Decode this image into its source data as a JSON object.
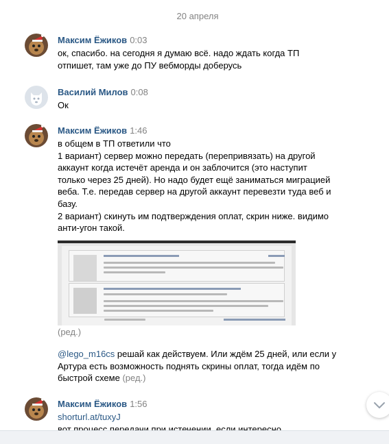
{
  "date_separator": "20 апреля",
  "messages": [
    {
      "author": "Максим Ёжиков",
      "time": "0:03",
      "lines": [
        "ок, спасибо. на сегодня я думаю всё. надо ждать когда ТП",
        "отпишет, там уже до ПУ вебморды доберусь"
      ]
    },
    {
      "author": "Василий Милов",
      "time": "0:08",
      "lines": [
        "Ок"
      ]
    },
    {
      "author": "Максим Ёжиков",
      "time": "1:46",
      "lines": [
        "в общем в ТП ответили что",
        "1 вариант) сервер можно передать (перепривязать) на другой",
        "аккаунт когда истечёт аренда и он заблочится (это наступит",
        "только через 25 дней). Но надо будет ещё заниматься миграцией",
        "веба. Т.е. передав сервер на другой аккаунт перевезти туда веб и",
        "базу.",
        "2 вариант) скинуть им подтверждения оплат, скрин ниже. видимо",
        "анти-угон такой."
      ],
      "edited_label": "(ред.)",
      "followup": {
        "mention": "@lego_m16cs",
        "line1_rest": " решай как действуем. Или ждём 25 дней, или если у",
        "line2": "Артура есть возможность поднять скрины оплат, тогда идём по",
        "line3": "быстрой схеме",
        "edited_label": "(ред.)"
      }
    },
    {
      "author": "Максим Ёжиков",
      "time": "1:56",
      "link": "shorturl.at/tuxyJ",
      "lines": [
        "вот процесс передачи при истечении, если интересно"
      ]
    }
  ]
}
